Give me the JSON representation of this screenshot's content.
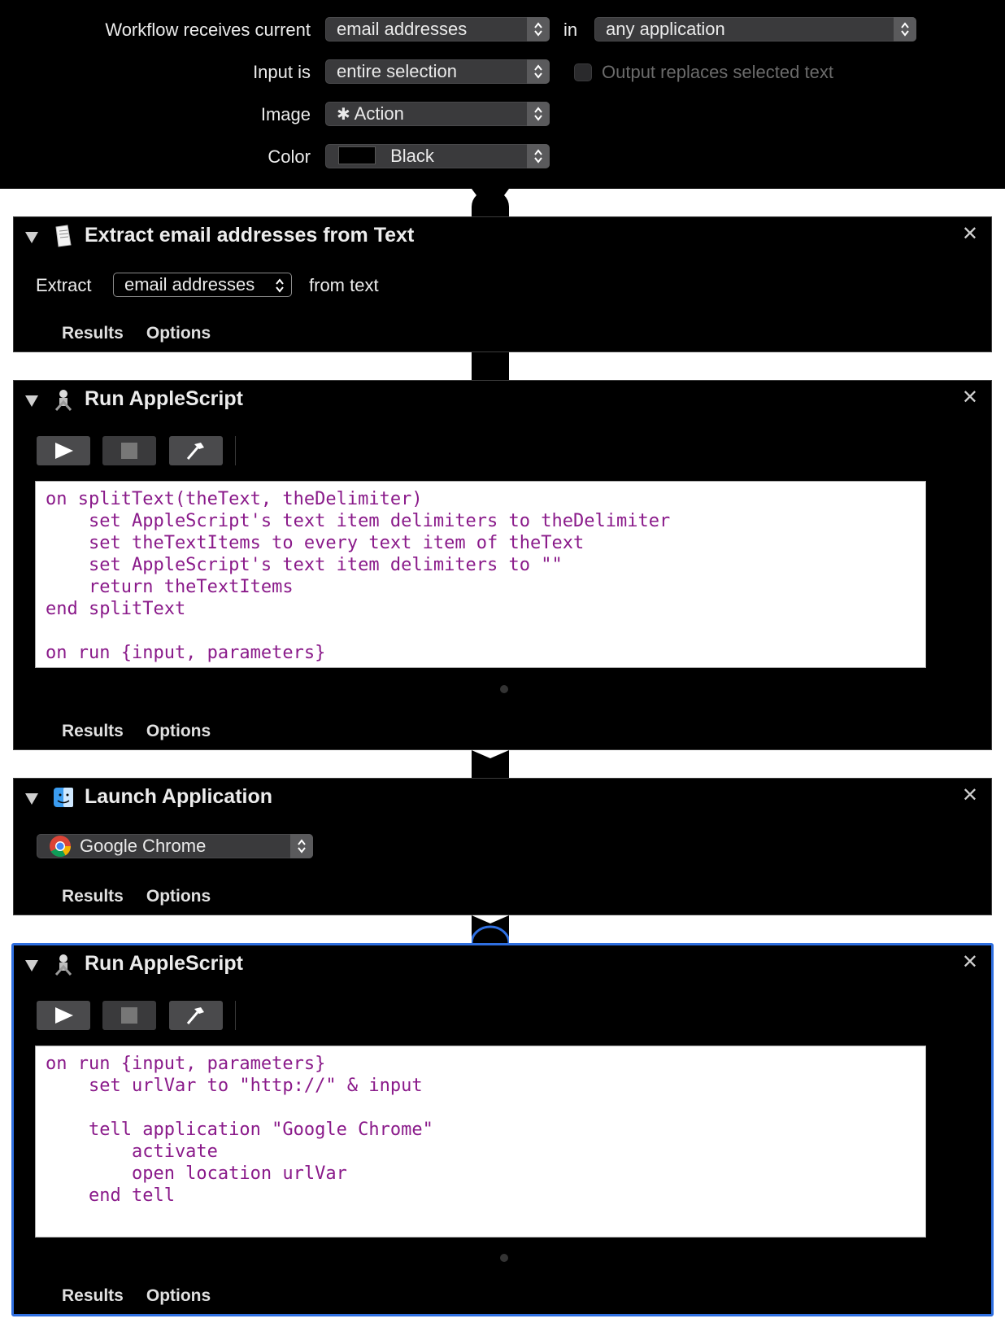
{
  "header": {
    "receives_label": "Workflow receives current",
    "receives_value": "email addresses",
    "in_label": "in",
    "app_value": "any application",
    "input_label": "Input is",
    "input_value": "entire selection",
    "replace_label": "Output replaces selected text",
    "replace_checked": false,
    "image_label": "Image",
    "image_value": "Action",
    "color_label": "Color",
    "color_value": "Black",
    "color_swatch": "#000000"
  },
  "actions": [
    {
      "title": "Extract email addresses from Text",
      "icon": "document-icon",
      "extract_label": "Extract",
      "extract_value": "email addresses",
      "from_label": "from text",
      "results": "Results",
      "options": "Options"
    },
    {
      "title": "Run AppleScript",
      "icon": "applescript-icon",
      "code": [
        "on splitText(theText, theDelimiter)",
        "    set AppleScript's text item delimiters to theDelimiter",
        "    set theTextItems to every text item of theText",
        "    set AppleScript's text item delimiters to \"\"",
        "    return theTextItems",
        "end splitText",
        "",
        "on run {input, parameters}"
      ],
      "results": "Results",
      "options": "Options"
    },
    {
      "title": "Launch Application",
      "icon": "finder-icon",
      "app_value": "Google Chrome",
      "results": "Results",
      "options": "Options"
    },
    {
      "title": "Run AppleScript",
      "icon": "applescript-icon",
      "code": [
        "on run {input, parameters}",
        "    set urlVar to \"http://\" & input",
        "",
        "    tell application \"Google Chrome\"",
        "        activate",
        "        open location urlVar",
        "    end tell"
      ],
      "results": "Results",
      "options": "Options"
    }
  ],
  "colors": {
    "selection_border": "#2f6fe0",
    "code_text": "#8a1a8a"
  }
}
